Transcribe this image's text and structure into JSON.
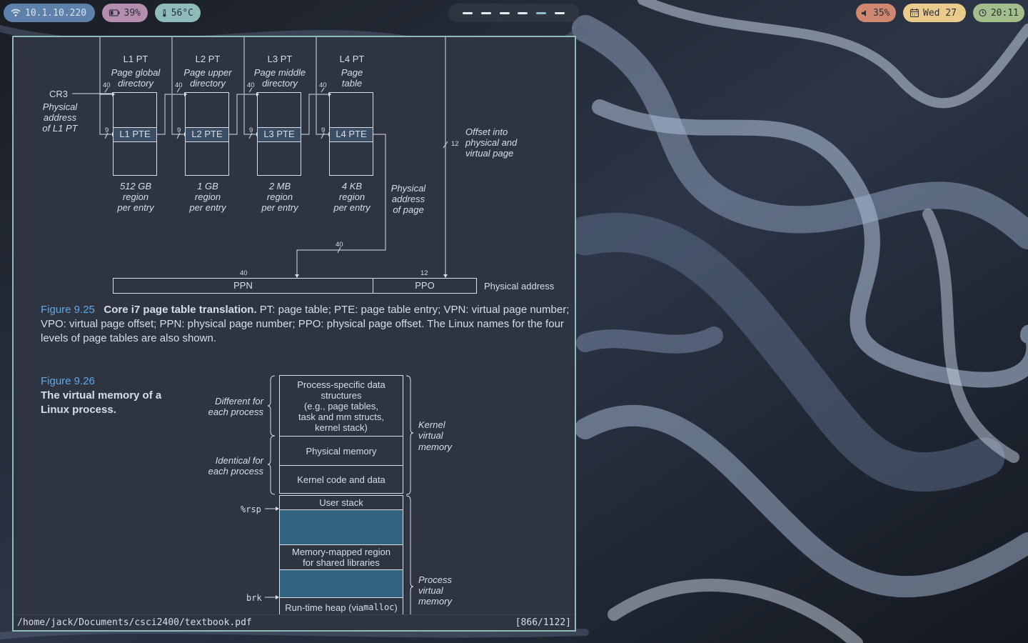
{
  "statusbar_top": {
    "ip": "10.1.10.220",
    "battery": "39%",
    "temp": "56°C",
    "volume": "35%",
    "date": "Wed 27",
    "time": "20:11"
  },
  "colors": {
    "ip_pill": "#5e81ac",
    "battery_pill": "#b48ead",
    "temp_pill": "#8fbcbb",
    "volume_pill": "#d08770",
    "date_pill": "#ebcb8b",
    "time_pill": "#a3be8c",
    "viewer_border": "#8fbcbb",
    "page_bg": "#2e3440",
    "figure_number": "#5fa8e8"
  },
  "viewer": {
    "path": "/home/jack/Documents/csci2400/textbook.pdf",
    "page_indicator": "[866/1122]"
  },
  "fig925": {
    "cr3": "CR3",
    "cr3_desc": [
      "Physical",
      "address",
      "of L1 PT"
    ],
    "tables": [
      {
        "title": "L1 PT",
        "desc": [
          "Page global",
          "directory"
        ],
        "pte": "L1 PTE",
        "region": [
          "512 GB",
          "region",
          "per entry"
        ]
      },
      {
        "title": "L2 PT",
        "desc": [
          "Page upper",
          "directory"
        ],
        "pte": "L2 PTE",
        "region": [
          "1 GB",
          "region",
          "per entry"
        ]
      },
      {
        "title": "L3 PT",
        "desc": [
          "Page middle",
          "directory"
        ],
        "pte": "L3 PTE",
        "region": [
          "2 MB",
          "region",
          "per entry"
        ]
      },
      {
        "title": "L4 PT",
        "desc": [
          "Page",
          "table"
        ],
        "pte": "L4 PTE",
        "region": [
          "4 KB",
          "region",
          "per entry"
        ]
      }
    ],
    "bits_40": "40",
    "bits_9": "9",
    "bits_12": "12",
    "offset_desc": [
      "Offset into",
      "physical and",
      "virtual page"
    ],
    "phys_page_desc": [
      "Physical",
      "address",
      "of page"
    ],
    "ppn": "PPN",
    "ppo": "PPO",
    "physical_address": "Physical address",
    "caption_number": "Figure 9.25",
    "caption_title": "Core i7 page table translation.",
    "caption_lines": [
      " PT: page table; PTE: page table entry; VPN: virtual page number;",
      "VPO: virtual page offset; PPN: physical page number; PPO: physical page offset. The Linux names for the four",
      "levels of page tables are also shown."
    ]
  },
  "fig926": {
    "caption_number": "Figure 9.26",
    "caption_title": [
      "The virtual memory of a",
      "Linux process."
    ],
    "different": [
      "Different for",
      "each process"
    ],
    "identical": [
      "Identical for",
      "each process"
    ],
    "kernel_vm": [
      "Kernel",
      "virtual",
      "memory"
    ],
    "process_vm": [
      "Process",
      "virtual",
      "memory"
    ],
    "blocks": {
      "proc_specific": [
        "Process-specific data",
        "structures",
        "(e.g., page tables,",
        "task and mm structs,",
        "kernel stack)"
      ],
      "physical_memory": "Physical memory",
      "kernel_code": "Kernel code and data",
      "user_stack": "User stack",
      "mmap": [
        "Memory-mapped region",
        "for shared libraries"
      ],
      "heap": "Run-time heap (via ",
      "heap_fn": "malloc",
      "heap_end": ")"
    },
    "rsp": "%rsp",
    "brk": "brk"
  }
}
